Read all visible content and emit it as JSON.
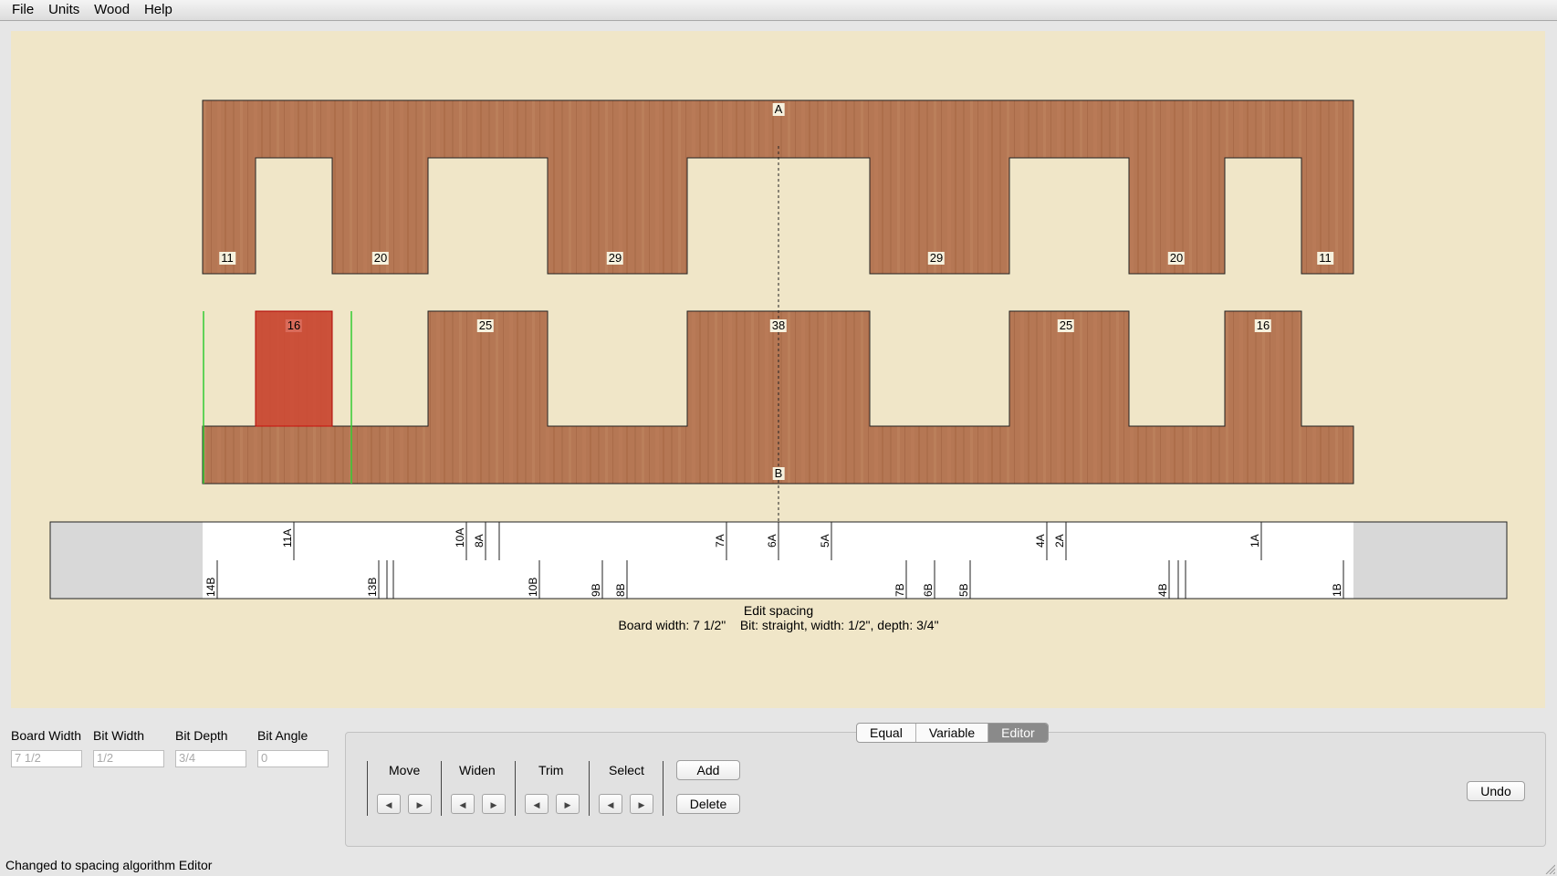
{
  "menu": [
    "File",
    "Units",
    "Wood",
    "Help"
  ],
  "board_a": {
    "label": "A",
    "tails": [
      {
        "label": "11"
      },
      {
        "label": "20"
      },
      {
        "label": "29"
      },
      {
        "label": "29"
      },
      {
        "label": "20"
      },
      {
        "label": "11"
      }
    ]
  },
  "board_b": {
    "label": "B",
    "pins": [
      {
        "label": "16",
        "selected": true
      },
      {
        "label": "25"
      },
      {
        "label": "38"
      },
      {
        "label": "25"
      },
      {
        "label": "16"
      }
    ]
  },
  "ruler": {
    "top_labels": [
      "11A",
      "10A",
      "8A",
      "7A",
      "6A",
      "5A",
      "4A",
      "2A",
      "1A"
    ],
    "bottom_labels": [
      "14B",
      "13B",
      "10B",
      "9B",
      "8B",
      "7B",
      "6B",
      "5B",
      "4B",
      "1B"
    ]
  },
  "caption": {
    "title": "Edit spacing",
    "details": "Board width: 7 1/2\"    Bit: straight, width: 1/2\", depth: 3/4\""
  },
  "fields": [
    {
      "label": "Board Width",
      "value": "7 1/2"
    },
    {
      "label": "Bit Width",
      "value": "1/2"
    },
    {
      "label": "Bit Depth",
      "value": "3/4"
    },
    {
      "label": "Bit Angle",
      "value": "0"
    }
  ],
  "tabs": [
    "Equal",
    "Variable",
    "Editor"
  ],
  "active_tab": "Editor",
  "groups": [
    "Move",
    "Widen",
    "Trim",
    "Select"
  ],
  "buttons": {
    "add": "Add",
    "delete": "Delete",
    "undo": "Undo"
  },
  "status": "Changed to spacing algorithm Editor",
  "colors": {
    "canvas": "#f0e6c8",
    "wood": "#b27452",
    "selected": "#d04a35",
    "guide": "#33cc33"
  }
}
